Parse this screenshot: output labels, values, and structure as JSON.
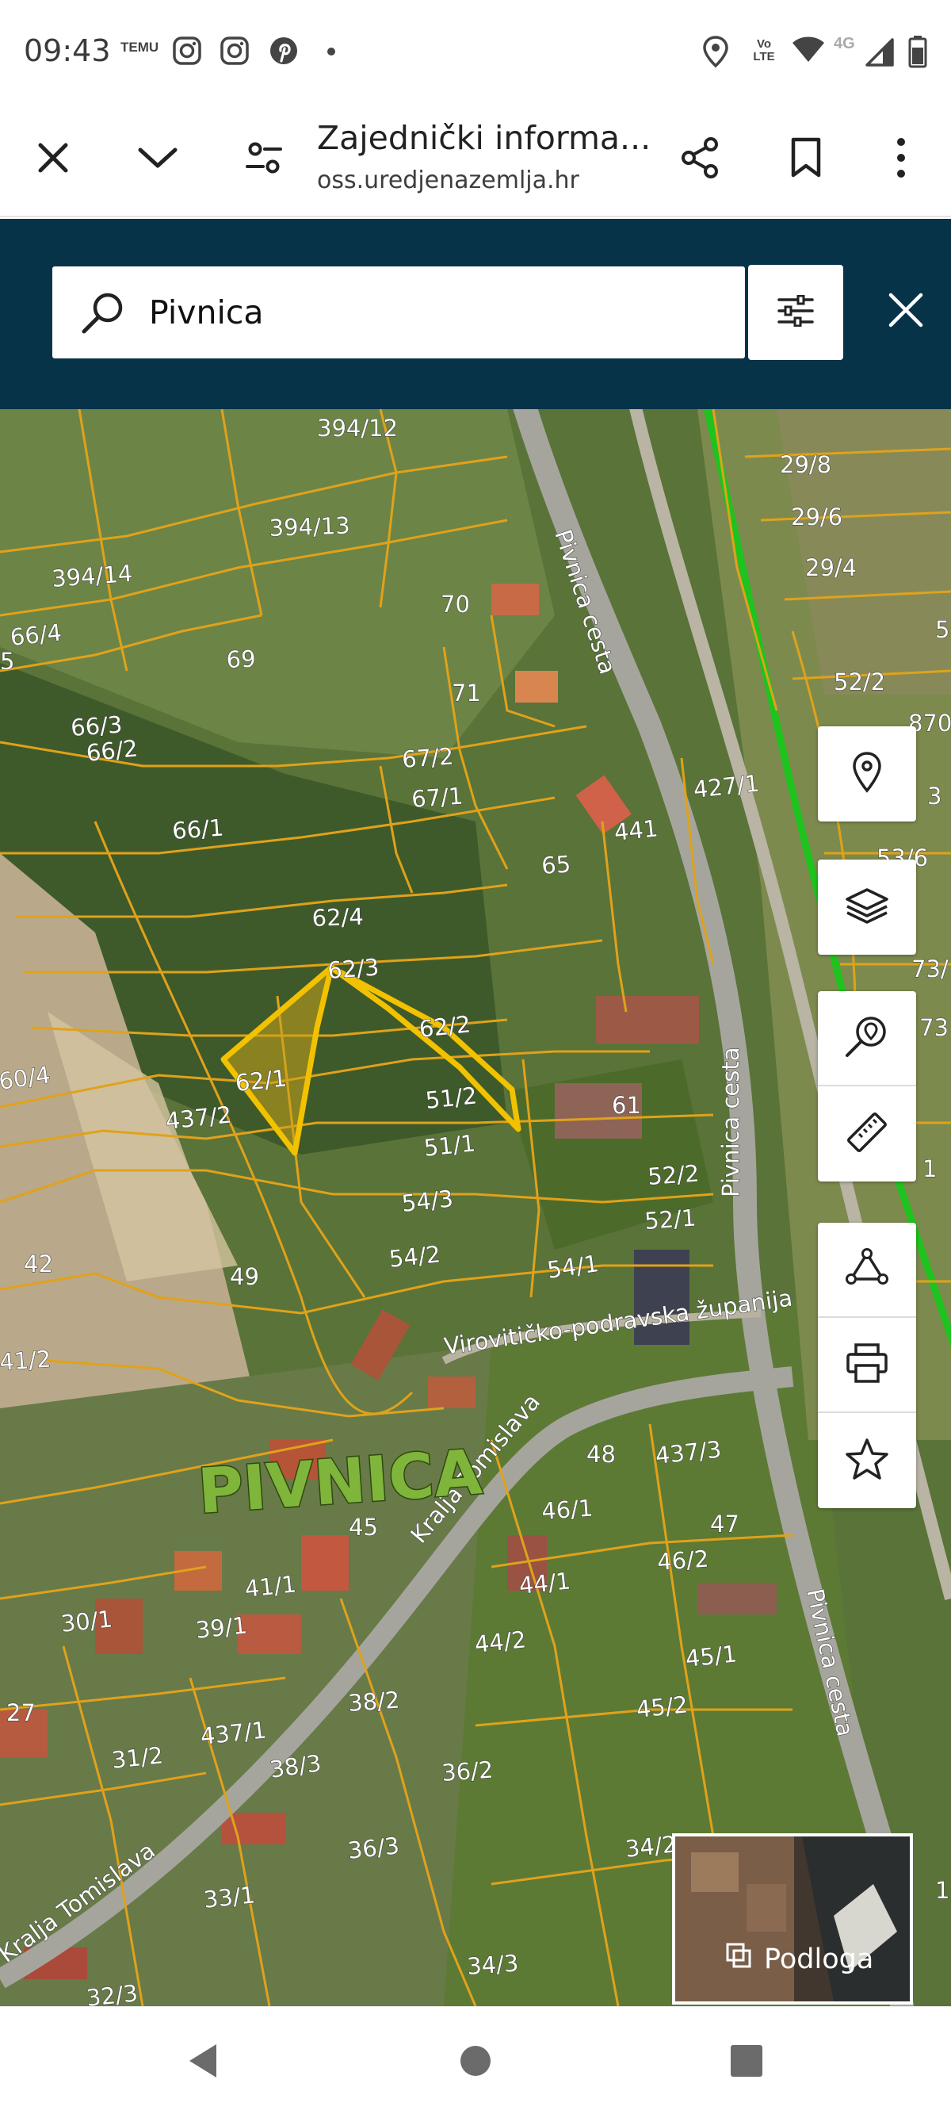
{
  "status_bar": {
    "time": "09:43",
    "left_icons": [
      "temu-icon",
      "instagram-icon",
      "instagram-icon",
      "pinterest-icon",
      "dot-icon"
    ],
    "temu_text": "TEMU",
    "right_icons": [
      "location-icon",
      "volte-icon",
      "wifi-icon",
      "signal-icon",
      "battery-icon"
    ],
    "volte_text": "Vo LTE",
    "network_text": "4G"
  },
  "browser": {
    "title": "Zajednički informa...",
    "url": "oss.uredjenazemlja.hr",
    "icons": [
      "close-icon",
      "chevron-down-icon",
      "site-settings-icon",
      "share-icon",
      "bookmark-icon",
      "more-icon"
    ]
  },
  "search": {
    "value": "Pivnica",
    "icons": [
      "search-icon",
      "filter-icon",
      "close-icon"
    ]
  },
  "map": {
    "parcels": [
      "394/12",
      "394/13",
      "394/14",
      "66/4",
      "5",
      "69",
      "70",
      "71",
      "66/3",
      "66/2",
      "67/2",
      "67/1",
      "66/1",
      "65",
      "441",
      "427/1",
      "62/4",
      "62/3",
      "62/2",
      "62/1",
      "60/4",
      "437/2",
      "51/2",
      "51/1",
      "61",
      "52/2",
      "52/1",
      "54/3",
      "54/2",
      "54/1",
      "42",
      "49",
      "41/2",
      "48",
      "437/3",
      "46/1",
      "47",
      "46/2",
      "45",
      "44/1",
      "41/1",
      "30/1",
      "39/1",
      "45/1",
      "44/2",
      "45/2",
      "27",
      "38/2",
      "437/1",
      "31/2",
      "38/3",
      "36/2",
      "36/3",
      "34/2",
      "33/1",
      "34/3",
      "32/3",
      "29/8",
      "29/6",
      "29/4",
      "52/2",
      "870",
      "3",
      "53/6",
      "73/",
      "73",
      "1",
      "5",
      "1"
    ],
    "roads": [
      "Pivnica cesta",
      "Pivnica cesta",
      "Pivnica cesta",
      "Virovitičko-podravska županija",
      "Kralja Tomislava",
      "Kralja Tomislava"
    ],
    "place_name": "PIVNICA",
    "highlight_color": "#f2c200",
    "parcel_line_color": "#e0a21a",
    "boundary_color": "#1ec31e"
  },
  "tools": {
    "group1": [
      "location-pin-icon",
      "layers-icon"
    ],
    "group2": [
      "search-location-icon",
      "ruler-icon"
    ],
    "group3": [
      "polygon-icon",
      "print-icon",
      "star-icon"
    ]
  },
  "basemap": {
    "label": "Podloga",
    "icon": "basemap-icon"
  },
  "nav": {
    "icons": [
      "back-icon",
      "home-icon",
      "recents-icon"
    ]
  }
}
